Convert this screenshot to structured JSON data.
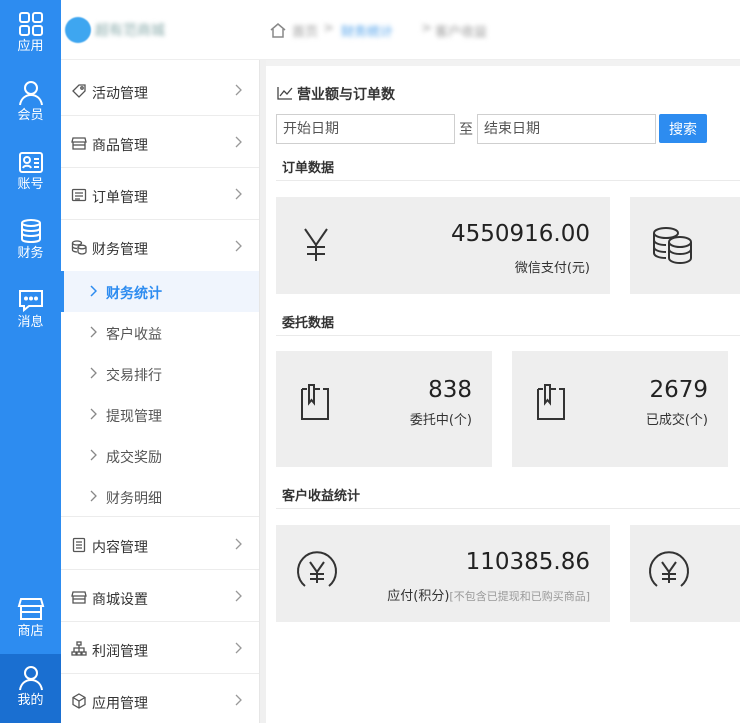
{
  "rail": {
    "items": [
      {
        "label": "应用",
        "icon": "grid-icon"
      },
      {
        "label": "会员",
        "icon": "user-icon"
      },
      {
        "label": "账号",
        "icon": "id-card-icon"
      },
      {
        "label": "财务",
        "icon": "coins-icon"
      },
      {
        "label": "消息",
        "icon": "chat-icon"
      },
      {
        "label": "商店",
        "icon": "store-icon"
      },
      {
        "label": "我的",
        "icon": "user-icon"
      }
    ]
  },
  "brand": {
    "name": "超有范商城"
  },
  "breadcrumb": {
    "home": "首页",
    "middle": "财务统计",
    "current": "客户收益"
  },
  "sidebar": {
    "menus": [
      {
        "label": "活动管理",
        "icon": "tag-icon"
      },
      {
        "label": "商品管理",
        "icon": "shop-icon"
      },
      {
        "label": "订单管理",
        "icon": "list-icon"
      },
      {
        "label": "财务管理",
        "icon": "coins-icon"
      },
      {
        "label": "内容管理",
        "icon": "document-icon"
      },
      {
        "label": "商城设置",
        "icon": "shop-icon"
      },
      {
        "label": "利润管理",
        "icon": "org-chart-icon"
      },
      {
        "label": "应用管理",
        "icon": "cube-icon"
      }
    ],
    "finance_sub": [
      "财务统计",
      "客户收益",
      "交易排行",
      "提现管理",
      "成交奖励",
      "财务明细"
    ],
    "active_sub": "财务统计"
  },
  "main": {
    "title": "营业额与订单数",
    "start_placeholder": "开始日期",
    "to_label": "至",
    "end_placeholder": "结束日期",
    "search_label": "搜索",
    "sections": {
      "orders": {
        "title": "订单数据",
        "cards": [
          {
            "value": "4550916.00",
            "label": "微信支付(元)"
          }
        ]
      },
      "entrust": {
        "title": "委托数据",
        "cards": [
          {
            "value": "838",
            "label": "委托中(个)"
          },
          {
            "value": "2679",
            "label": "已成交(个)"
          }
        ]
      },
      "income": {
        "title": "客户收益统计",
        "cards": [
          {
            "value": "110385.86",
            "label": "应付(积分)",
            "hint": "[不包含已提现和已购买商品]"
          }
        ]
      }
    }
  },
  "colors": {
    "primary": "#2d8cf0",
    "card_bg": "#eeeeee",
    "active_sub_bg": "#f0f5fd"
  }
}
